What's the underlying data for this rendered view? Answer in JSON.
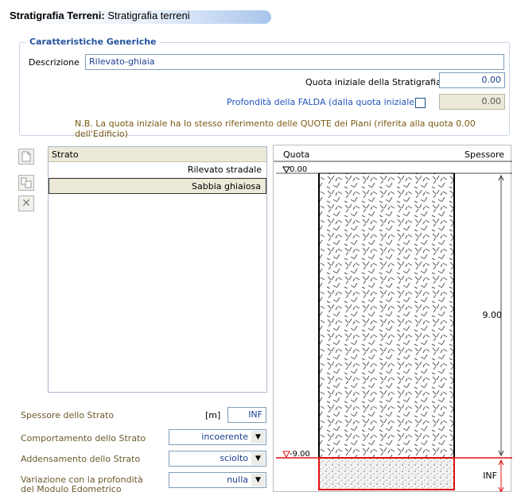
{
  "header": {
    "title_bold": "Stratigrafia Terreni:",
    "title_rest": "Stratigrafia terreni"
  },
  "group": {
    "title": "Caratteristiche Generiche",
    "descrizione_label": "Descrizione",
    "descrizione_value": "Rilevato-ghiaia",
    "quota_label": "Quota iniziale della Stratigrafia",
    "quota_value": "0.00",
    "falda_label": "Profondità della FALDA (dalla quota iniziale)",
    "falda_value": "0.00",
    "note": "N.B. La quota iniziale ha lo stesso riferimento delle QUOTE dei Piani (riferita alla quota 0.00 dell'Edificio)"
  },
  "toolbar": {
    "new_icon": "new-document-icon",
    "copy_icon": "copy-icon",
    "delete_icon": "delete-icon",
    "delete_glyph": "✕"
  },
  "list": {
    "header": "Strato",
    "rows": [
      "Rilevato stradale",
      "Sabbia ghiaiosa"
    ]
  },
  "properties": {
    "spessore_label": "Spessore dello Strato",
    "spessore_unit": "[m]",
    "spessore_value": "INF",
    "comportamento_label": "Comportamento dello Strato",
    "comportamento_value": "incoerente",
    "addensamento_label": "Addensamento dello Strato",
    "addensamento_value": "sciolto",
    "variazione_label_1": "Variazione con la profondità",
    "variazione_label_2": "del Modulo Edometrico",
    "variazione_value": "nulla"
  },
  "diagram": {
    "quota_header": "Quota",
    "spessore_header": "Spessore",
    "quota_top": "0.00",
    "quota_bottom": "-9.00",
    "spessore_1": "9.00",
    "spessore_2": "INF",
    "colors": {
      "highlight": "#e01010",
      "fill_hatch": "#555555"
    }
  }
}
